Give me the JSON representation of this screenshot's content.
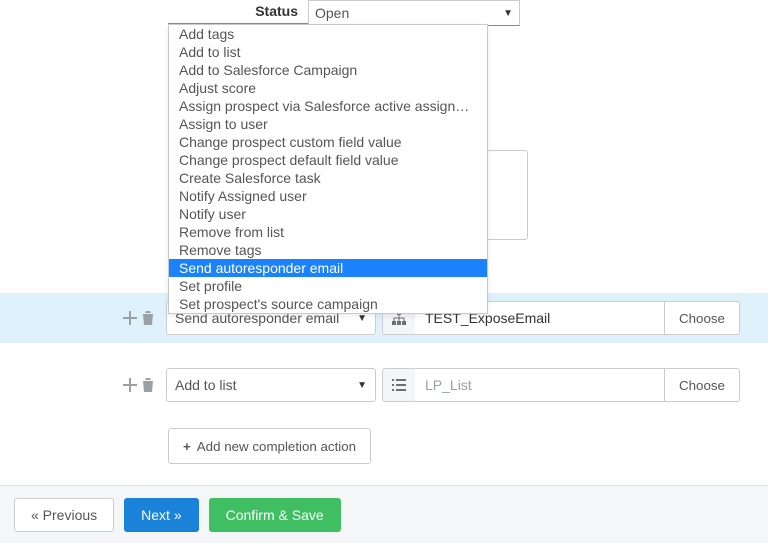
{
  "status": {
    "label": "Status",
    "value": "Open"
  },
  "dropdown": {
    "options": [
      "Add tags",
      "Add to list",
      "Add to Salesforce Campaign",
      "Adjust score",
      "Assign prospect via Salesforce active assignment rule",
      "Assign to user",
      "Change prospect custom field value",
      "Change prospect default field value",
      "Create Salesforce task",
      "Notify Assigned user",
      "Notify user",
      "Remove from list",
      "Remove tags",
      "Send autoresponder email",
      "Set profile",
      "Set prospect's source campaign"
    ],
    "selected_index": 13
  },
  "actions": [
    {
      "select": "Send autoresponder email",
      "input_value": "TEST_ExposeEmail",
      "input_placeholder": "",
      "choose": "Choose",
      "icon": "org-chart"
    },
    {
      "select": "Add to list",
      "input_value": "",
      "input_placeholder": "LP_List",
      "choose": "Choose",
      "icon": "list"
    }
  ],
  "add_completion_label": "Add new completion action",
  "footer": {
    "previous": "« Previous",
    "next": "Next »",
    "confirm": "Confirm & Save"
  }
}
